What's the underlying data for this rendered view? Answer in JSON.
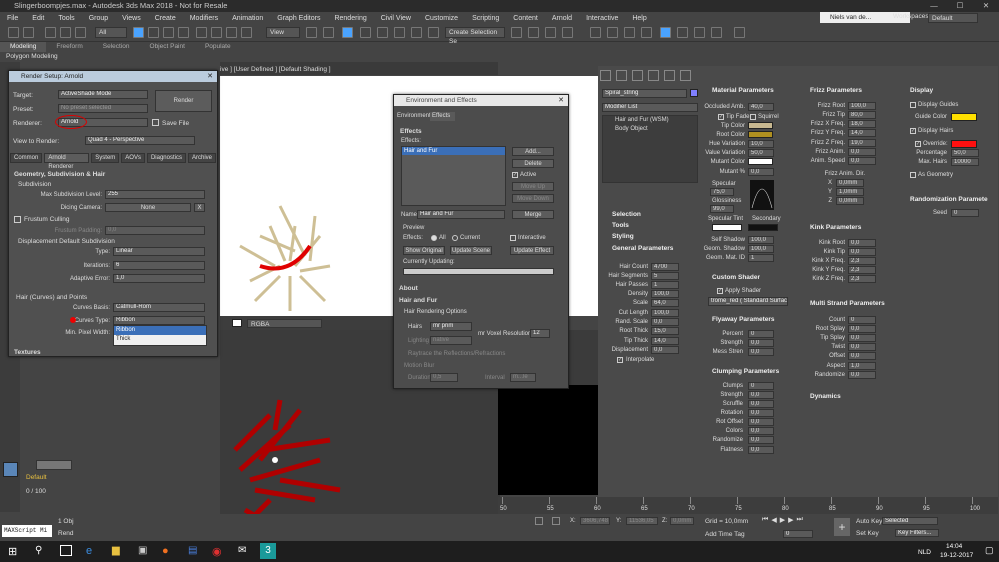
{
  "app": {
    "title": "Slingerboompjes.max - Autodesk 3ds Max 2018 - Not for Resale",
    "user": "Niels van de...",
    "workspaces_label": "Workspaces:",
    "workspace": "Default"
  },
  "menu": [
    "File",
    "Edit",
    "Tools",
    "Group",
    "Views",
    "Create",
    "Modifiers",
    "Animation",
    "Graph Editors",
    "Rendering",
    "Civil View",
    "Customize",
    "Scripting",
    "Content",
    "Arnold",
    "Interactive",
    "Help"
  ],
  "toolbar": {
    "filter": "All",
    "view": "View",
    "selection_set": "Create Selection Se"
  },
  "ribbon": {
    "tabs": [
      "Modeling",
      "Freeform",
      "Selection",
      "Object Paint",
      "Populate"
    ],
    "active": "Modeling",
    "sub": "Polygon Modeling"
  },
  "viewport": {
    "label": "[+] [User Defined ] [Default Shading ]",
    "label_visible": "ive ] [User Defined ] [Default Shading ]"
  },
  "render_setup": {
    "title": "Render Setup: Arnold",
    "target_label": "Target:",
    "target": "ActiveShade Mode",
    "preset_label": "Preset:",
    "preset": "No preset selected",
    "renderer_label": "Renderer:",
    "renderer": "Arnold",
    "save_file": "Save File",
    "view_label": "View to Render:",
    "view": "Quad 4 - Perspective",
    "render_btn": "Render",
    "tabs": [
      "Common",
      "Arnold Renderer",
      "System",
      "AOVs",
      "Diagnostics",
      "Archive"
    ],
    "section_geo": "Geometry, Subdivision & Hair",
    "subdivision": "Subdivision",
    "max_subdiv_label": "Max Subdivision Level:",
    "max_subdiv": "255",
    "dicing_label": "Dicing Camera:",
    "dicing": "None",
    "dicing_x": "X",
    "frustum_culling": "Frustum Culling",
    "frustum_padding_label": "Frustum Padding:",
    "frustum_padding": "0,0",
    "disp_default": "Displacement Default Subdivision",
    "type_label": "Type:",
    "type": "Linear",
    "iterations_label": "Iterations:",
    "iterations": "6",
    "adaptive_label": "Adaptive Error:",
    "adaptive": "1,0",
    "hair_title": "Hair (Curves) and Points",
    "curves_basis_label": "Curves Basis:",
    "curves_basis": "Catmull-Rom",
    "curves_type_label": "Curves Type:",
    "curves_type": "Ribbon",
    "min_pixel_label": "Min. Pixel Width:",
    "options": [
      "Ribbon",
      "Thick"
    ],
    "textures": "Textures",
    "rgba": "RGBA"
  },
  "env": {
    "title": "Environment and Effects",
    "tabs": [
      "Environment",
      "Effects"
    ],
    "effects_section": "Effects",
    "effects_label": "Effects:",
    "effect_item": "Hair and Fur",
    "add": "Add...",
    "delete": "Delete",
    "active": "Active",
    "move_up": "Move Up",
    "move_down": "Move Down",
    "name_label": "Name:",
    "name": "Hair and Fur",
    "merge": "Merge",
    "preview": "Preview",
    "effects_radio": "Effects:",
    "all": "All",
    "current": "Current",
    "interactive": "Interactive",
    "show_original": "Show Original",
    "update_scene": "Update Scene",
    "update_effect": "Update Effect",
    "currently_updating": "Currently Updating:",
    "about": "About",
    "hair_fur": "Hair and Fur",
    "hair_render_options": "Hair Rendering Options",
    "hairs_label": "Hairs",
    "hairs": "mr prim",
    "voxel_label": "mr Voxel Resolution",
    "voxel": "12",
    "lighting_label": "Lighting",
    "lighting": "native",
    "raytrace": "Raytrace the Reflections/Refractions",
    "motion_blur": "Motion Blur",
    "duration_label": "Duration",
    "duration": "0,5",
    "interval_label": "Interval",
    "interval": "m...le"
  },
  "modifier": {
    "object": "Spiral_string",
    "list": "Modifier List",
    "items": [
      "Hair and Fur (WSM)",
      "Body Object"
    ]
  },
  "rollouts": {
    "selection": "Selection",
    "tools": "Tools",
    "styling": "Styling",
    "general": "General Parameters",
    "hair_count": [
      "Hair Count",
      "4700"
    ],
    "hair_segments": [
      "Hair Segments",
      "5"
    ],
    "hair_passes": [
      "Hair Passes",
      "1"
    ],
    "density": [
      "Density",
      "100,0"
    ],
    "scale": [
      "Scale",
      "64,0"
    ],
    "cut_length": [
      "Cut Length",
      "100,0"
    ],
    "rand_scale": [
      "Rand. Scale",
      "0,0"
    ],
    "root_thick": [
      "Root Thick",
      "15,0"
    ],
    "tip_thick": [
      "Tip Thick",
      "14,0"
    ],
    "displacement": [
      "Displacement",
      "0,0"
    ],
    "interpolate": "Interpolate"
  },
  "material": {
    "title": "Material Parameters",
    "occluded": [
      "Occluded Amb.",
      "40,0"
    ],
    "tip_fade": "Tip Fade",
    "squirrel": "Squirrel",
    "tip_color": "Tip Color",
    "root_color": "Root Color",
    "hue_var": [
      "Hue Variation",
      "10,0"
    ],
    "value_var": [
      "Value Variation",
      "50,0"
    ],
    "mutant_color": "Mutant Color",
    "mutant_pct": [
      "Mutant %",
      "0,0"
    ],
    "specular": [
      "Specular",
      "75,0"
    ],
    "glossiness": [
      "Glossiness",
      "99,0"
    ],
    "specular_tint": "Specular Tint",
    "secondary": "Secondary",
    "self_shadow": [
      "Self Shadow",
      "100,0"
    ],
    "geom_shadow": [
      "Geom. Shadow",
      "100,0"
    ],
    "geom_mat": [
      "Geom. Mat. ID",
      "1"
    ],
    "custom_shader": "Custom Shader",
    "apply_shader": "Apply Shader",
    "shader_name": "trome_red ( Standard Surface",
    "flyaway": "Flyaway Parameters",
    "percent": [
      "Percent",
      "0"
    ],
    "strength": [
      "Strength",
      "0,0"
    ],
    "mess": [
      "Mess Stren",
      "0,0"
    ],
    "clumping": "Clumping Parameters",
    "clumps": [
      "Clumps",
      "0"
    ],
    "c_strength": [
      "Strength",
      "0,0"
    ],
    "scruffle": [
      "Scruffle",
      "0,0"
    ],
    "rotation": [
      "Rotation",
      "0,0"
    ],
    "rot_offset": [
      "Rot Offset",
      "0,0"
    ],
    "colors": [
      "Colors",
      "0,0"
    ],
    "randomize": [
      "Randomize",
      "0,0"
    ],
    "flatness": [
      "Flatness",
      "0,0"
    ]
  },
  "frizz": {
    "title": "Frizz Parameters",
    "root": [
      "Frizz Root",
      "100,0"
    ],
    "tip": [
      "Frizz Tip",
      "80,0"
    ],
    "xf": [
      "Frizz X Freq.",
      "18,0"
    ],
    "yf": [
      "Frizz Y Freq.",
      "14,0"
    ],
    "zf": [
      "Frizz Z Freq.",
      "19,0"
    ],
    "anim": [
      "Frizz Anim.",
      "0,0"
    ],
    "speed": [
      "Anim. Speed",
      "0,0"
    ],
    "dir": "Frizz Anim. Dir.",
    "x": [
      "X",
      "0,0mm"
    ],
    "y": [
      "Y",
      "1,0mm"
    ],
    "z": [
      "Z",
      "0,0mm"
    ],
    "kink": "Kink Parameters",
    "kroot": [
      "Kink Root",
      "0,0"
    ],
    "ktip": [
      "Kink Tip",
      "0,0"
    ],
    "kx": [
      "Kink X Freq.",
      "2,3"
    ],
    "ky": [
      "Kink Y Freq.",
      "2,3"
    ],
    "kz": [
      "Kink Z Freq.",
      "2,3"
    ],
    "multi": "Multi Strand Parameters",
    "count": [
      "Count",
      "0"
    ],
    "root_splay": [
      "Root Splay",
      "0,0"
    ],
    "tip_splay": [
      "Tip Splay",
      "0,0"
    ],
    "twist": [
      "Twist",
      "0,0"
    ],
    "offset": [
      "Offset",
      "0,0"
    ],
    "aspect": [
      "Aspect",
      "1,0"
    ],
    "rand": [
      "Randomize",
      "0,0"
    ],
    "dynamics": "Dynamics"
  },
  "display": {
    "title": "Display",
    "guides": "Display Guides",
    "guide_color": "Guide Color",
    "hairs": "Display Hairs",
    "override": "Override:",
    "percentage": [
      "Percentage",
      "50,0"
    ],
    "max_hairs": [
      "Max. Hairs",
      "10000"
    ],
    "as_geometry": "As Geometry",
    "rand_params": "Randomization Paramete",
    "seed": [
      "Seed",
      "0"
    ]
  },
  "colors": {
    "tip": "#c8b890",
    "root": "#b09020",
    "guide": "#ffe000",
    "override": "#ff1010",
    "accent": "#c00000"
  },
  "timeline": {
    "ticks": [
      "50",
      "55",
      "60",
      "65",
      "70",
      "75",
      "80",
      "85",
      "90",
      "95",
      "100"
    ]
  },
  "status": {
    "frame": "0 / 100",
    "default": "Default",
    "script": "MAXScript Mi",
    "obj": "1 Obj",
    "rend": "Rend",
    "x": "3606,748",
    "y": "11536,05",
    "z": "0,0mm",
    "grid": "Grid = 10,0mm",
    "add_time_tag": "Add Time Tag",
    "auto_key": "Auto Key",
    "selected": "Selected",
    "set_key": "Set Key",
    "key_filters": "Key Filters...",
    "frame_field": "0"
  },
  "taskbar": {
    "lang": "NLD",
    "time": "14:04",
    "date": "19-12-2017"
  }
}
